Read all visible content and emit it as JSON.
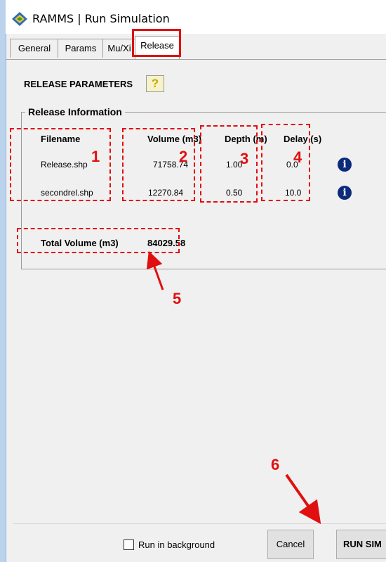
{
  "window": {
    "title": "RAMMS | Run Simulation"
  },
  "tabs": [
    {
      "label": "General"
    },
    {
      "label": "Params"
    },
    {
      "label": "Mu/Xi"
    },
    {
      "label": "Release"
    }
  ],
  "section": {
    "header": "RELEASE PARAMETERS",
    "help_glyph": "?"
  },
  "group": {
    "title": "Release Information",
    "columns": {
      "filename": "Filename",
      "volume": "Volume (m3)",
      "depth": "Depth (m)",
      "delay": "Delay (s)"
    },
    "rows": [
      {
        "filename": "Release.shp",
        "volume": "71758.74",
        "depth": "1.00",
        "delay": "0.0"
      },
      {
        "filename": "secondrel.shp",
        "volume": "12270.84",
        "depth": "0.50",
        "delay": "10.0"
      }
    ],
    "total_label": "Total Volume (m3)",
    "total_value": "84029.58"
  },
  "annotations": [
    "1",
    "2",
    "3",
    "4",
    "5",
    "6"
  ],
  "footer": {
    "background_label": "Run in background",
    "cancel_label": "Cancel",
    "run_label": "RUN SIM"
  },
  "colors": {
    "annotation": "#e01010",
    "info_icon": "#0b2a7a"
  }
}
